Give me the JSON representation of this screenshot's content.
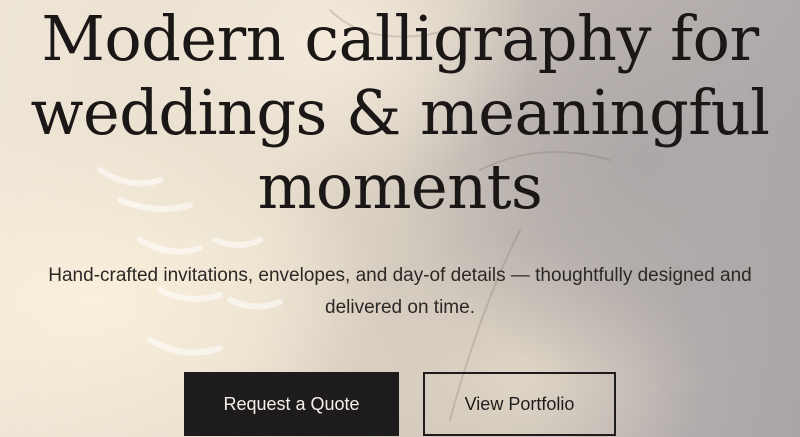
{
  "hero": {
    "headline_lines": [
      "Modern calligraphy for",
      "weddings & meaningful",
      "moments"
    ],
    "subtext_lines": [
      "Hand-crafted invitations, envelopes, and day-of details — thoughtfully designed and",
      "delivered on time."
    ],
    "background_image": "calligraphy-paper-photo"
  },
  "actions": {
    "primary_label": "Request a Quote",
    "secondary_label": "View Portfolio"
  },
  "colors": {
    "text_dark": "#1a1716",
    "button_dark": "#1d1b1b",
    "button_text_light": "#f5f1ea"
  }
}
